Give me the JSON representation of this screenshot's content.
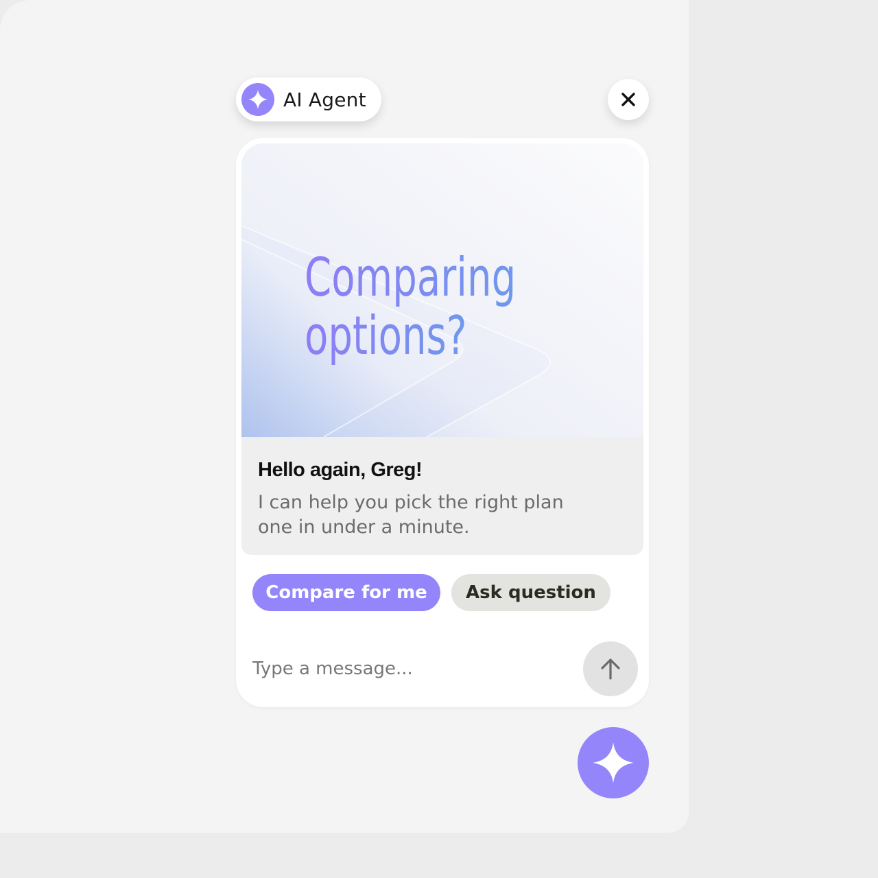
{
  "agent": {
    "name": "AI Agent",
    "icon": "sparkle-icon"
  },
  "close_icon": "close-icon",
  "promo": {
    "headline_line1": "Comparing",
    "headline_line2": "options?"
  },
  "greeting": {
    "title": "Hello again, Greg!",
    "body": "I can help you pick the right plan one in under a minute."
  },
  "actions": {
    "primary_label": "Compare for me",
    "secondary_label": "Ask question"
  },
  "composer": {
    "placeholder": "Type a message...",
    "send_icon": "arrow-up-icon"
  },
  "launcher_icon": "sparkle-icon",
  "colors": {
    "accent": "#9585fb",
    "secondary_chip": "#e3e4df",
    "greeting_bg": "#efefef"
  }
}
